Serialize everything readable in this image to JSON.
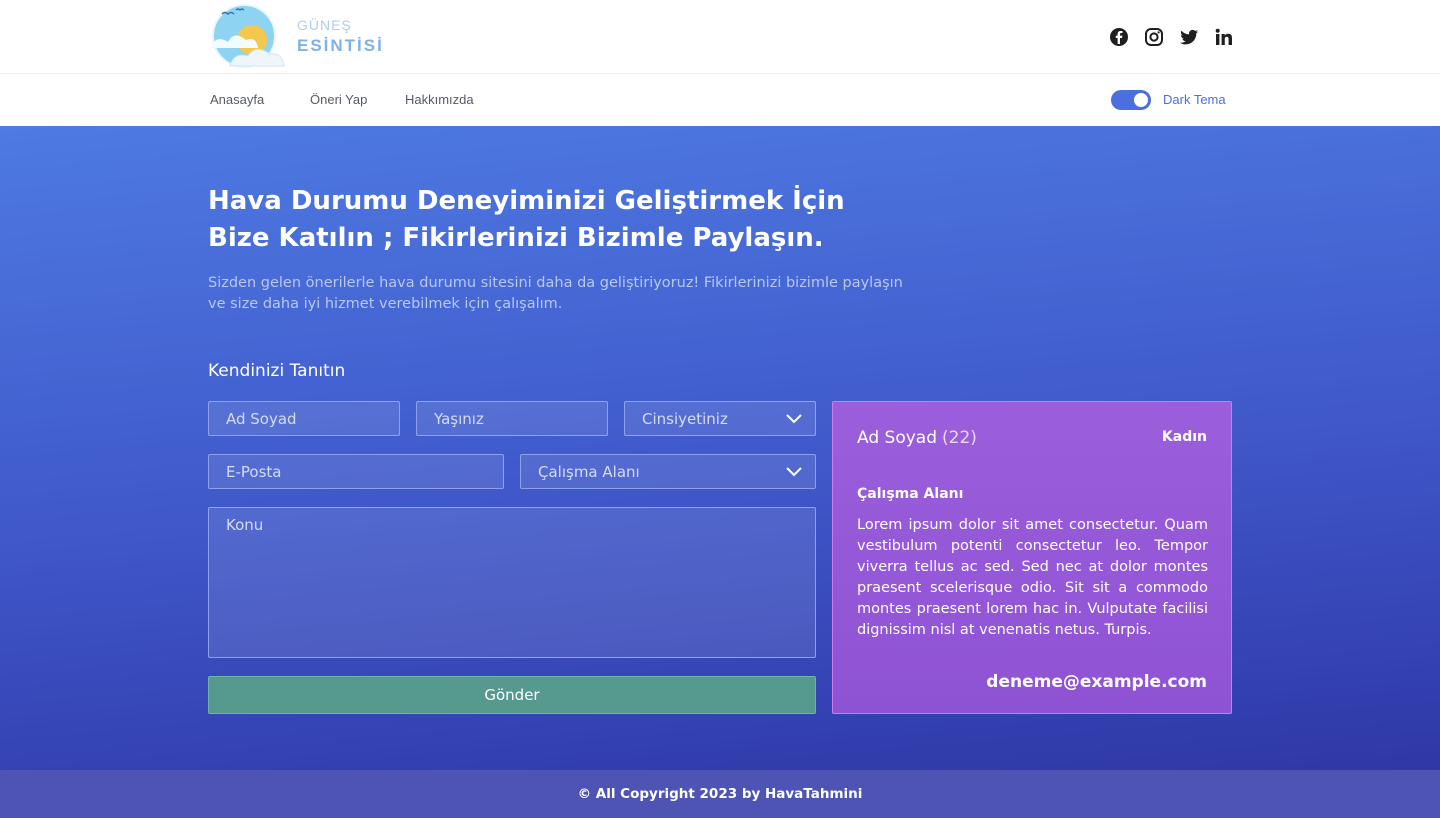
{
  "logo": {
    "line1": "GÜNEŞ",
    "line2": "ESİNTİSİ"
  },
  "social": [
    "facebook-icon",
    "instagram-icon",
    "twitter-icon",
    "linkedin-icon"
  ],
  "nav": {
    "items": [
      {
        "label": "Anasayfa"
      },
      {
        "label": "Öneri Yap"
      },
      {
        "label": "Hakkımızda"
      }
    ]
  },
  "theme": {
    "label": "Dark Tema",
    "enabled": true
  },
  "hero": {
    "title": "Hava Durumu Deneyiminizi Geliştirmek İçin Bize Katılın ; Fikirlerinizi Bizimle Paylaşın.",
    "subtitle": "Sizden gelen önerilerle hava durumu sitesini daha da geliştiriyoruz! Fikirlerinizi bizimle paylaşın ve size daha iyi hizmet verebilmek için çalışalım."
  },
  "form": {
    "heading": "Kendinizi Tanıtın",
    "name_placeholder": "Ad Soyad",
    "age_placeholder": "Yaşınız",
    "gender_placeholder": "Cinsiyetiniz",
    "email_placeholder": "E-Posta",
    "field_placeholder": "Çalışma Alanı",
    "subject_placeholder": "Konu",
    "submit_label": "Gönder"
  },
  "preview": {
    "name": "Ad Soyad",
    "age": "(22)",
    "gender": "Kadın",
    "field": "Çalışma Alanı",
    "description": "Lorem ipsum dolor sit amet consectetur. Quam vestibulum potenti consectetur leo. Tempor viverra tellus ac sed. Sed nec at dolor montes praesent scelerisque odio. Sit sit a commodo montes praesent lorem hac in. Vulputate facilisi dignissim nisl at venenatis netus. Turpis.",
    "email": "deneme@example.com"
  },
  "footer": {
    "copyright": "© All Copyright 2023 by HavaTahmini"
  },
  "colors": {
    "accent": "#4c6fe0",
    "submit": "#55998f",
    "card": "#9b5fdc",
    "footer": "#4d54b4"
  }
}
